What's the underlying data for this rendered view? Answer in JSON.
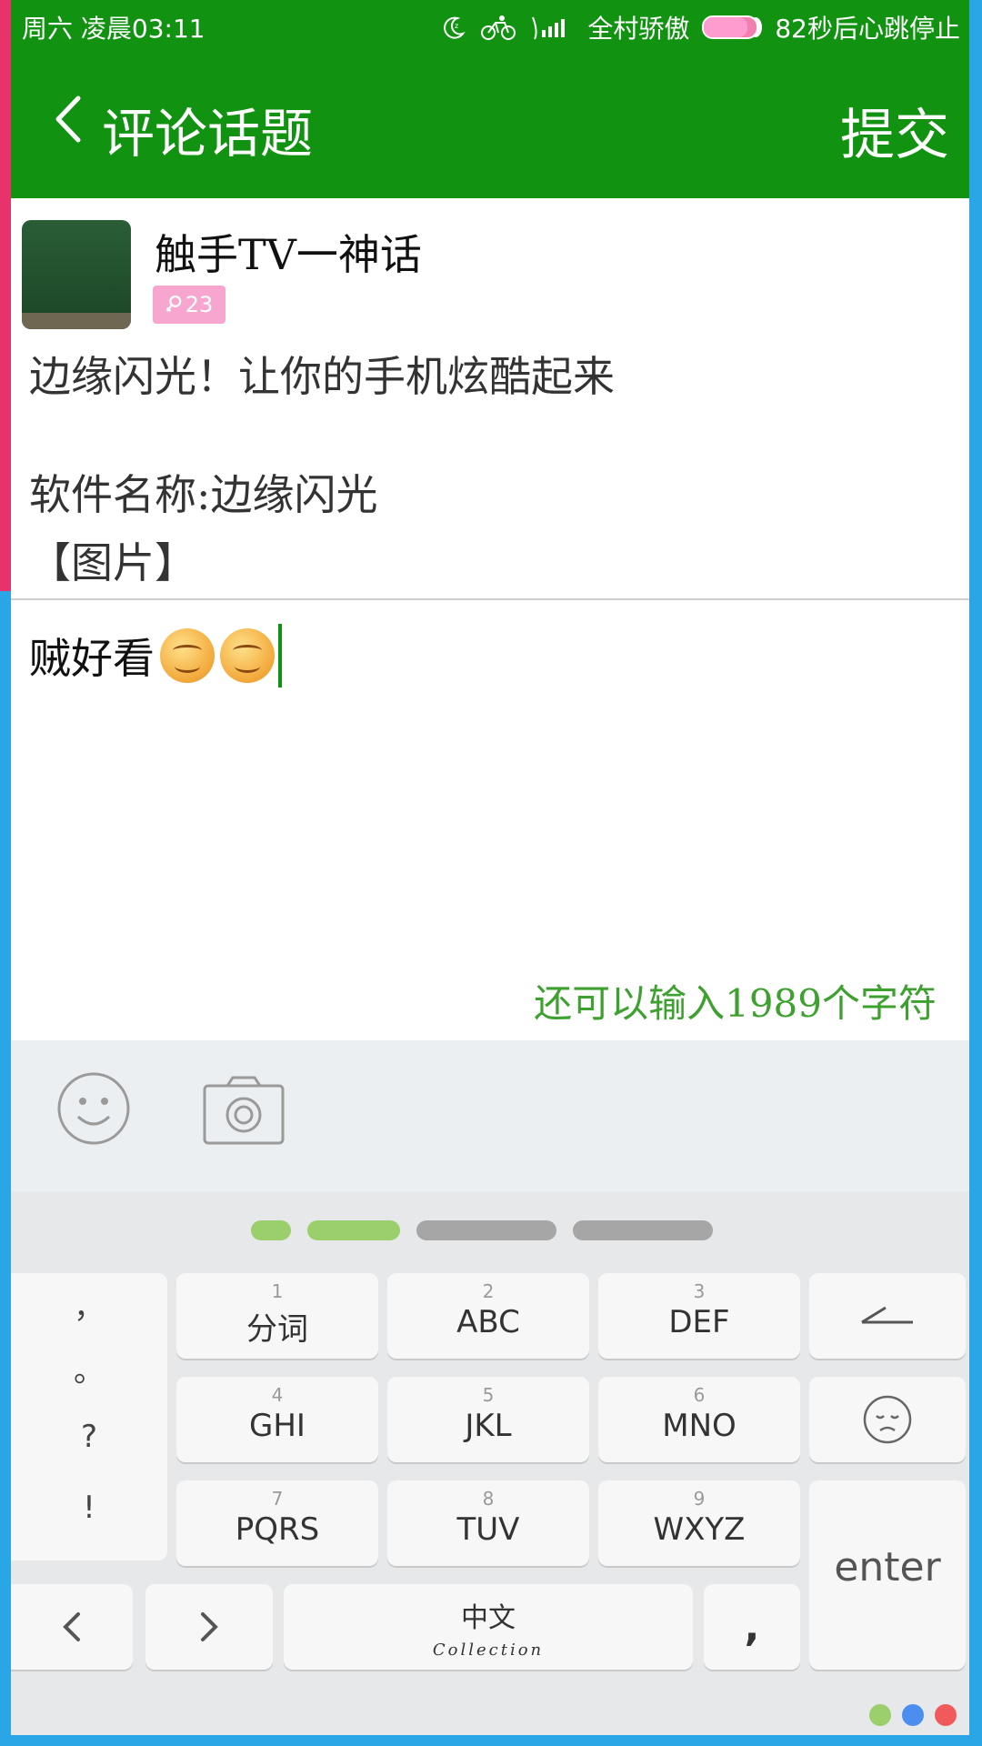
{
  "status_bar": {
    "time": "周六 凌晨03:11",
    "carrier": "全村骄傲",
    "battery_text": "82秒后心跳停止",
    "battery_level": 0.82,
    "icons": [
      "moon-icon",
      "bike-icon",
      "signal-icon",
      "battery-icon"
    ]
  },
  "header": {
    "title": "评论话题",
    "submit_label": "提交",
    "back_icon": "chevron-left-icon"
  },
  "post": {
    "author": "触手TV一神话",
    "badge_count": "23",
    "badge_icon": "female-icon",
    "lines": [
      "边缘闪光！让你的手机炫酷起来",
      "软件名称:边缘闪光",
      "【图片】"
    ]
  },
  "comment": {
    "text": "贼好看",
    "emoji_count": 2,
    "remaining": "还可以输入1989个字符"
  },
  "toolbar": {
    "emoji_icon": "smiley-icon",
    "camera_icon": "camera-icon"
  },
  "keyboard": {
    "punctuation": [
      "，",
      "。",
      "?",
      "!"
    ],
    "rows": [
      [
        {
          "num": "1",
          "label": "分词"
        },
        {
          "num": "2",
          "label": "ABC"
        },
        {
          "num": "3",
          "label": "DEF"
        }
      ],
      [
        {
          "num": "4",
          "label": "GHI"
        },
        {
          "num": "5",
          "label": "JKL"
        },
        {
          "num": "6",
          "label": "MNO"
        }
      ],
      [
        {
          "num": "7",
          "label": "PQRS"
        },
        {
          "num": "8",
          "label": "TUV"
        },
        {
          "num": "9",
          "label": "WXYZ"
        }
      ]
    ],
    "enter_label": "enter",
    "ime_label": "中文",
    "ime_sub": "Collection",
    "comma_label": ",",
    "icons": [
      "backspace-icon",
      "emoji-face-icon",
      "arrow-left-icon",
      "arrow-right-icon"
    ],
    "pager_active": 2,
    "pager_total": 4,
    "theme_colors": [
      "#9bcf6c",
      "#4b8ef0",
      "#f05a5a"
    ]
  }
}
